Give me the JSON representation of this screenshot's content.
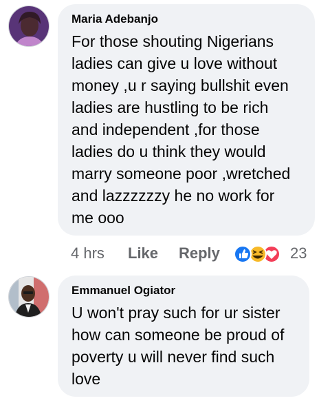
{
  "comments": [
    {
      "author": "Maria Adebanjo",
      "text": "For those shouting Nigerians\nladies can give u love without\nmoney ,u r saying bullshit even\nladies are hustling to be rich\nand independent ,for those\nladies do u think they would\nmarry someone poor ,wretched\nand lazzzzzzy he no work for\nme ooo",
      "time": "4 hrs",
      "like_label": "Like",
      "reply_label": "Reply",
      "reaction_count": "23",
      "reactions": [
        "like-icon",
        "haha-icon",
        "love-icon"
      ]
    },
    {
      "author": "Emmanuel Ogiator",
      "text": "U won't pray such for ur sister\nhow can someone be proud of\npoverty u will never find such\nlove"
    }
  ],
  "colors": {
    "bubble": "#f0f2f5",
    "meta_text": "#65676b",
    "like_blue": "#1877f2",
    "love_red": "#f33e58",
    "haha_yellow": "#f7b928"
  }
}
